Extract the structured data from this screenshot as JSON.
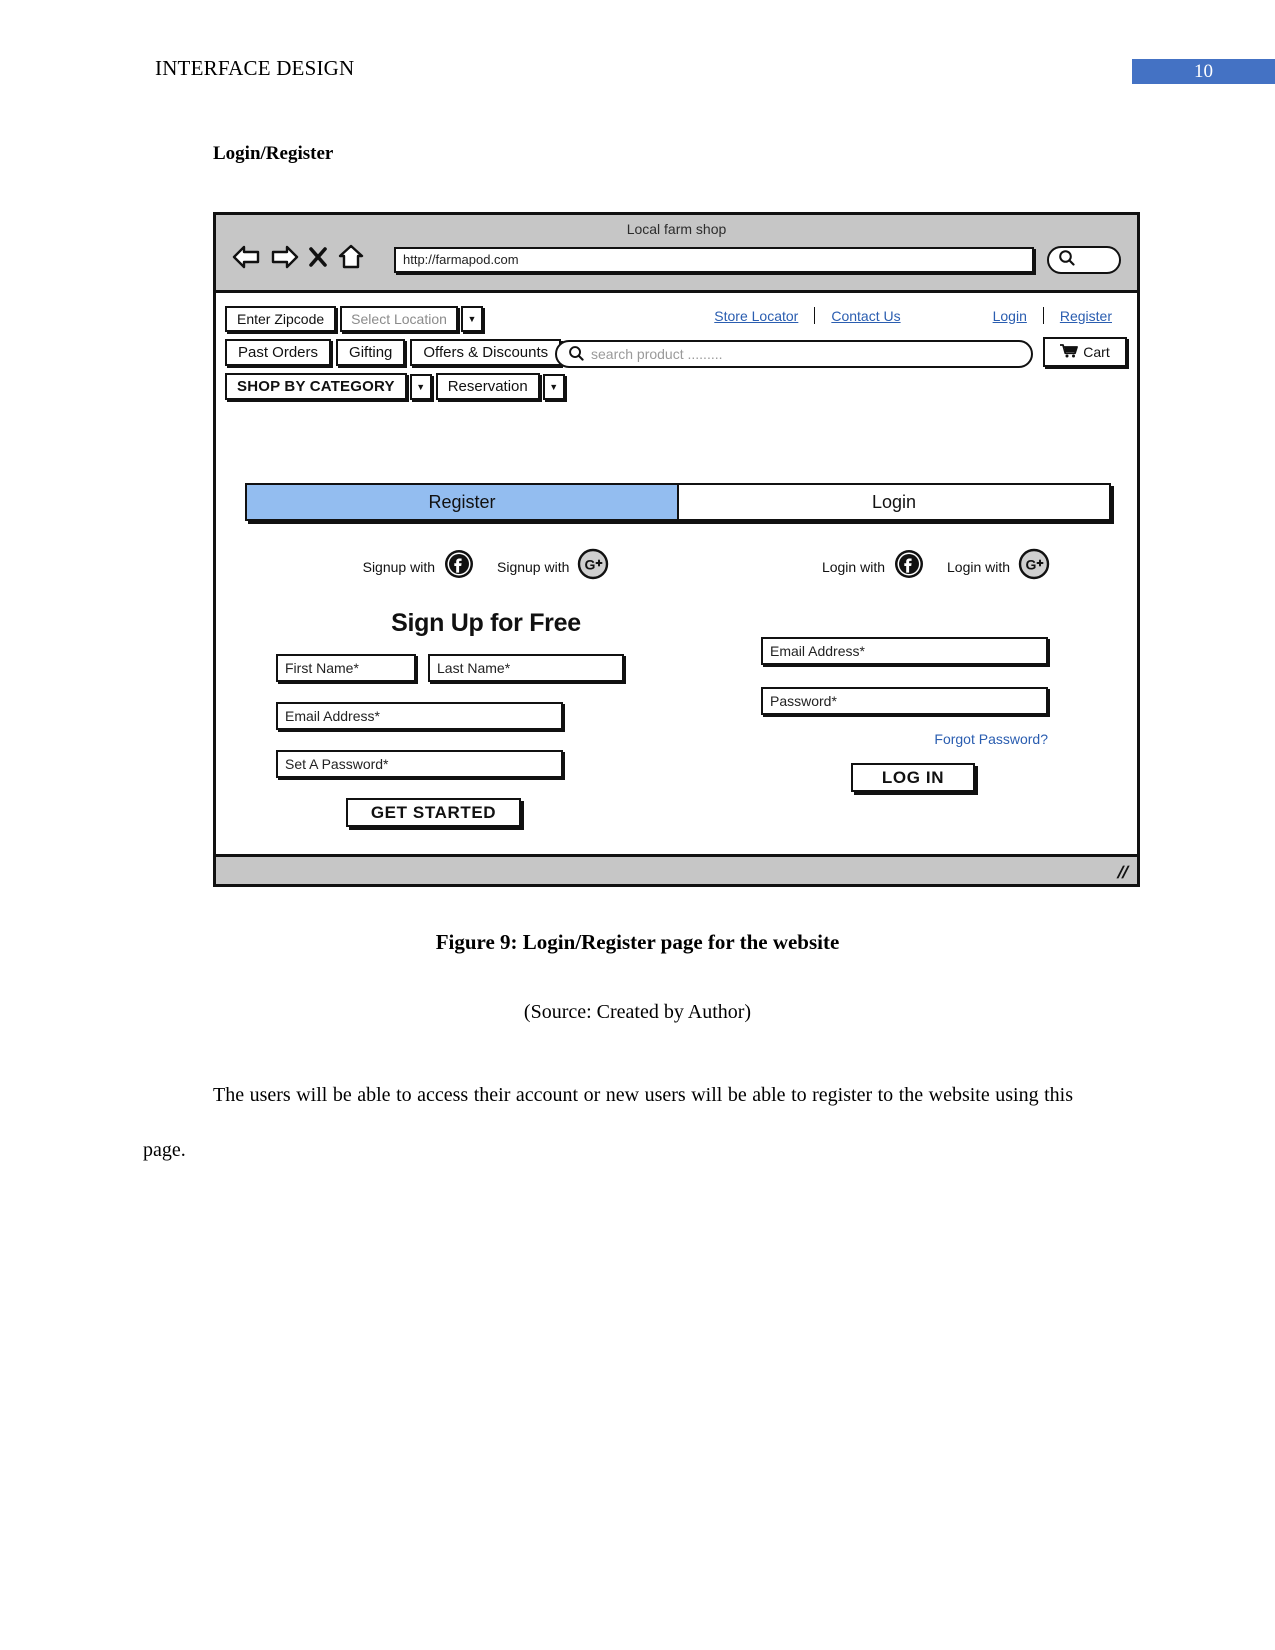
{
  "document": {
    "running_head": "INTERFACE DESIGN",
    "page_number": "10",
    "section_heading": "Login/Register",
    "figure_caption": "Figure 9: Login/Register page for the website",
    "figure_source": "(Source: Created by Author)",
    "body_paragraph": "The users will be able to access their account or new users will be able to register to the website using this page."
  },
  "colors": {
    "page_badge_bg": "#4472C4",
    "tab_active_bg": "#93bdf0",
    "link_blue": "#2a5db0",
    "chrome_gray": "#c6c6c6"
  },
  "mockup": {
    "chrome": {
      "title": "Local farm shop",
      "url": "http://farmapod.com",
      "icons": [
        "back-arrow-icon",
        "forward-arrow-icon",
        "close-icon",
        "home-icon",
        "search-icon"
      ]
    },
    "nav": {
      "zipcode_button": "Enter Zipcode",
      "location_select": "Select Location",
      "menu_items": [
        "Past Orders",
        "Gifting",
        "Offers & Discounts"
      ],
      "category_button": "SHOP BY CATEGORY",
      "reservation_button": "Reservation",
      "links": [
        "Store Locator",
        "Contact Us",
        "Login",
        "Register"
      ],
      "search_placeholder": "search product .........",
      "cart_label": "Cart"
    },
    "tabs": [
      {
        "label": "Register",
        "active": true
      },
      {
        "label": "Login",
        "active": false
      }
    ],
    "register_panel": {
      "social": [
        {
          "label": "Signup with",
          "icon": "facebook-icon"
        },
        {
          "label": "Signup with",
          "icon": "google-plus-icon"
        }
      ],
      "title": "Sign Up for Free",
      "fields": [
        {
          "placeholder": "First Name*"
        },
        {
          "placeholder": "Last Name*"
        },
        {
          "placeholder": "Email Address*"
        },
        {
          "placeholder": "Set A Password*"
        }
      ],
      "cta": "GET STARTED"
    },
    "login_panel": {
      "social": [
        {
          "label": "Login with",
          "icon": "facebook-icon"
        },
        {
          "label": "Login with",
          "icon": "google-plus-icon"
        }
      ],
      "fields": [
        {
          "placeholder": "Email Address*"
        },
        {
          "placeholder": "Password*"
        }
      ],
      "forgot_password": "Forgot Password?",
      "cta": "LOG IN"
    }
  }
}
